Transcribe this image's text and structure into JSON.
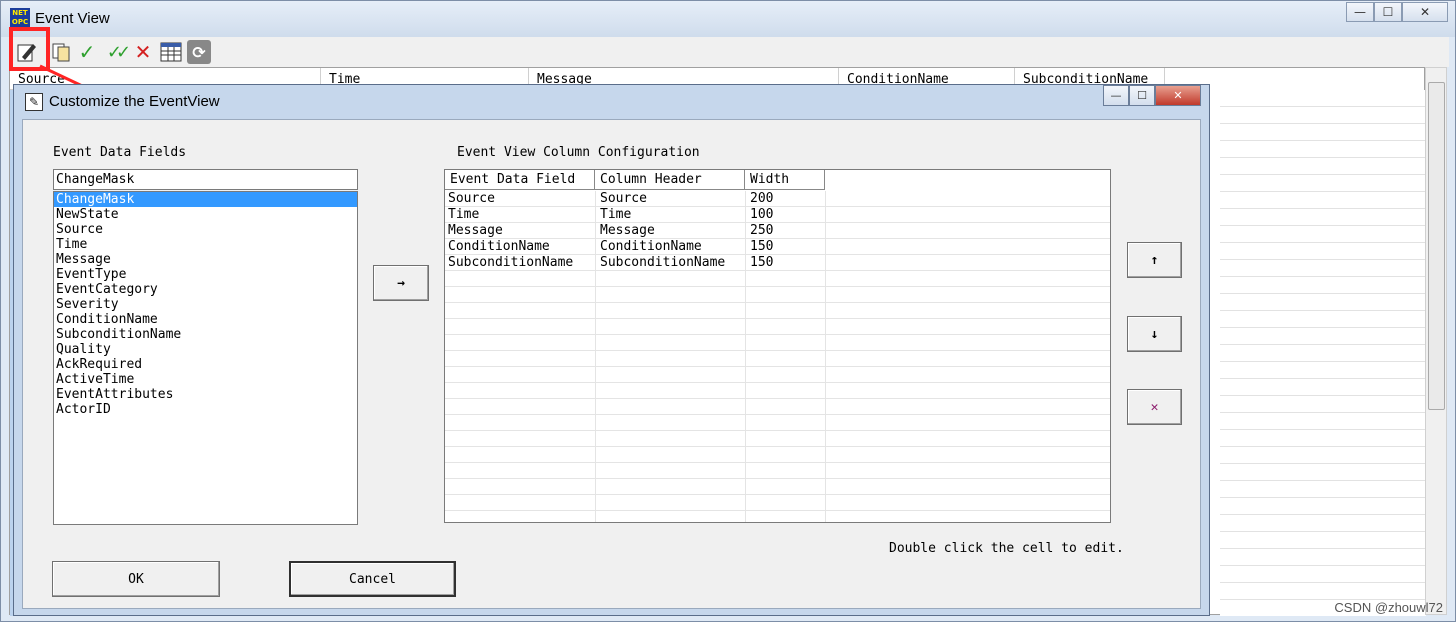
{
  "main_window": {
    "title": "Event View",
    "app_icon_text": "NET OPC",
    "columns": [
      "Source",
      "Time",
      "Message",
      "ConditionName",
      "SubconditionName"
    ],
    "controls": {
      "minimize": "—",
      "maximize": "☐",
      "close": "✕"
    }
  },
  "toolbar": {
    "icons": [
      "customize-icon",
      "copy-icon",
      "acknowledge-icon",
      "acknowledge-all-icon",
      "delete-icon",
      "table-icon",
      "refresh-icon"
    ],
    "check": "✓",
    "check_double": "✓✓",
    "delete": "✕",
    "refresh": "⟳"
  },
  "dialog": {
    "title": "Customize the EventView",
    "icon": "✎",
    "controls": {
      "minimize": "—",
      "maximize": "☐",
      "close": "✕"
    },
    "event_data_fields_label": "Event Data Fields",
    "field_input_value": "ChangeMask",
    "fields": [
      "ChangeMask",
      "NewState",
      "Source",
      "Time",
      "Message",
      "EventType",
      "EventCategory",
      "Severity",
      "ConditionName",
      "SubconditionName",
      "Quality",
      "AckRequired",
      "ActiveTime",
      "EventAttributes",
      "ActorID"
    ],
    "selected_field": "ChangeMask",
    "add_button": "→",
    "column_config_label": "Event View Column Configuration",
    "table_headers": [
      "Event Data Field",
      "Column Header",
      "Width"
    ],
    "rows": [
      {
        "field": "Source",
        "header": "Source",
        "width": "200"
      },
      {
        "field": "Time",
        "header": "Time",
        "width": "100"
      },
      {
        "field": "Message",
        "header": "Message",
        "width": "250"
      },
      {
        "field": "ConditionName",
        "header": "ConditionName",
        "width": "150"
      },
      {
        "field": "SubconditionName",
        "header": "SubconditionName",
        "width": "150"
      }
    ],
    "move_up_button": "↑",
    "move_down_button": "↓",
    "remove_button": "✕",
    "hint": "Double click the cell to edit.",
    "ok_button": "OK",
    "cancel_button": "Cancel"
  },
  "watermark": "CSDN @zhouwl72",
  "colors": {
    "highlight": "#ff2424",
    "selection": "#3399ff",
    "remove": "#8b1a6b",
    "check": "#2ea02e",
    "delete": "#d42020"
  }
}
